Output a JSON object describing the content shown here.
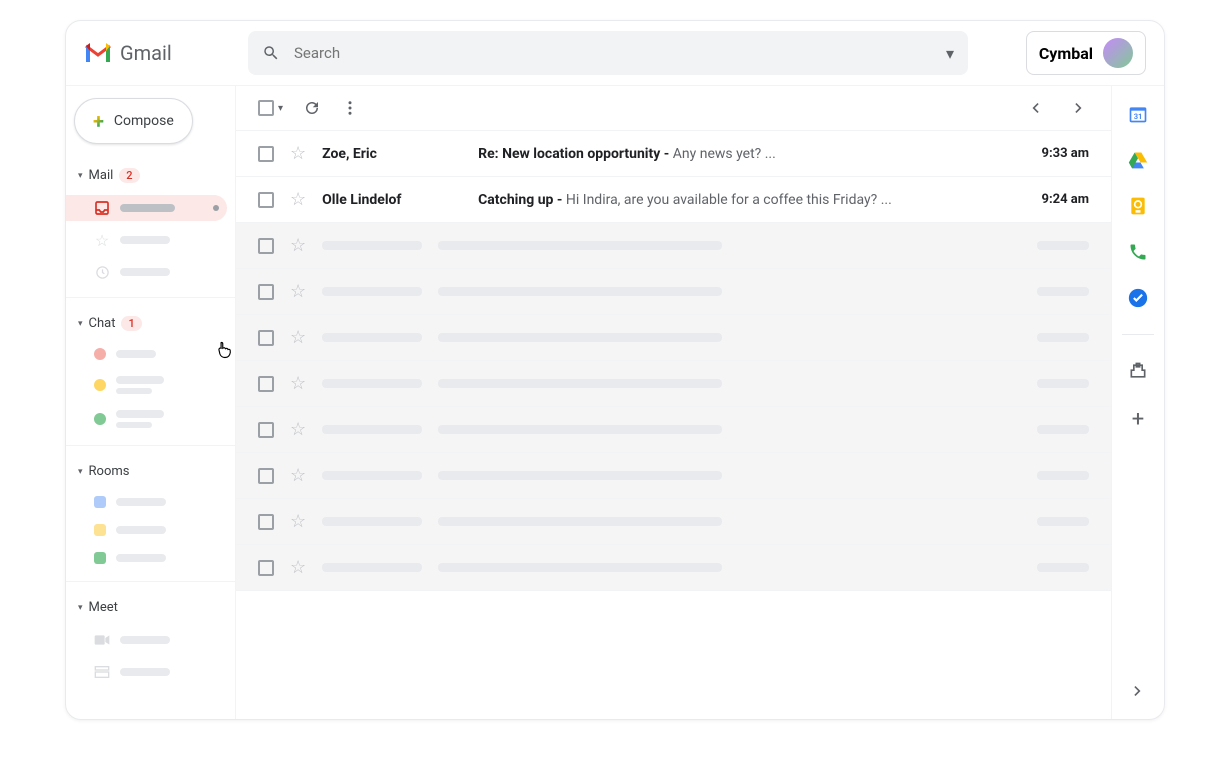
{
  "header": {
    "app_name": "Gmail",
    "search_placeholder": "Search",
    "brand_name": "Cymbal"
  },
  "sidebar": {
    "compose_label": "Compose",
    "sections": {
      "mail": {
        "label": "Mail",
        "badge": "2"
      },
      "chat": {
        "label": "Chat",
        "badge": "1"
      },
      "rooms": {
        "label": "Rooms"
      },
      "meet": {
        "label": "Meet"
      }
    }
  },
  "emails": [
    {
      "sender": "Zoe, Eric",
      "subject": "Re: New location opportunity",
      "snippet": "Any news yet? ...",
      "time": "9:33 am",
      "unread": true
    },
    {
      "sender": "Olle Lindelof",
      "subject": "Catching up",
      "snippet": "Hi Indira, are you available for a coffee this Friday? ...",
      "time": "9:24 am",
      "unread": true
    }
  ],
  "placeholder_row_count": 8
}
